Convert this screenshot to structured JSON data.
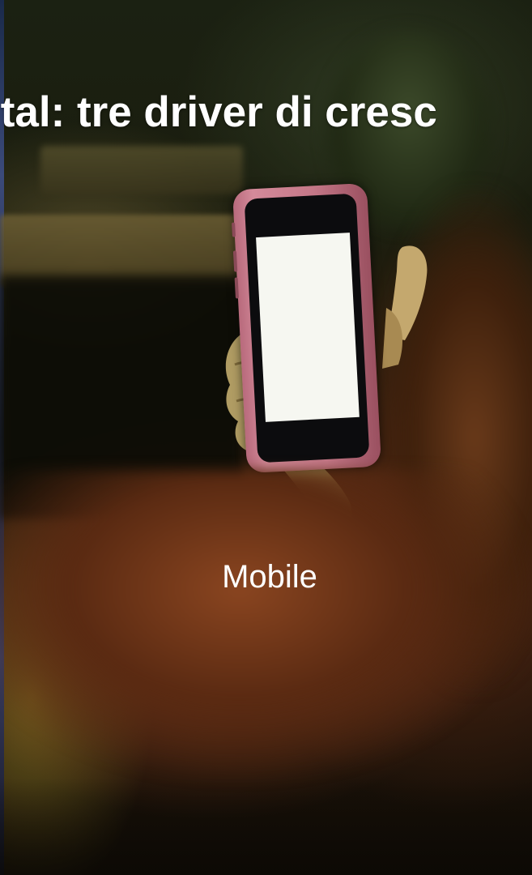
{
  "slide": {
    "title": "ital: tre driver di cresc",
    "caption": "Mobile"
  },
  "photo": {
    "subject_icon": "phone-in-hand-icon"
  },
  "colors": {
    "text": "#ffffff",
    "phone_case": "#c57888",
    "phone_screen": "#f6f7f1"
  }
}
